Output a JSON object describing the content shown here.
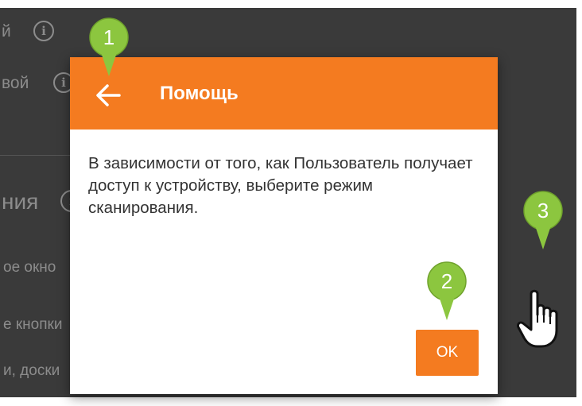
{
  "background": {
    "row1_text": "й",
    "row2_text": "вой",
    "section_heading": "ния",
    "item1": "ое окно",
    "item2": "е кнопки",
    "item3": "и, доски"
  },
  "dialog": {
    "title": "Помощь",
    "body": "В зависимости от того, как Пользователь получает доступ к устройству, выберите режим сканирования.",
    "ok_label": "OK",
    "accent_color": "#f47b20"
  },
  "annotations": {
    "marker1": "1",
    "marker2": "2",
    "marker3": "3",
    "marker_color": "#8cc63f"
  }
}
